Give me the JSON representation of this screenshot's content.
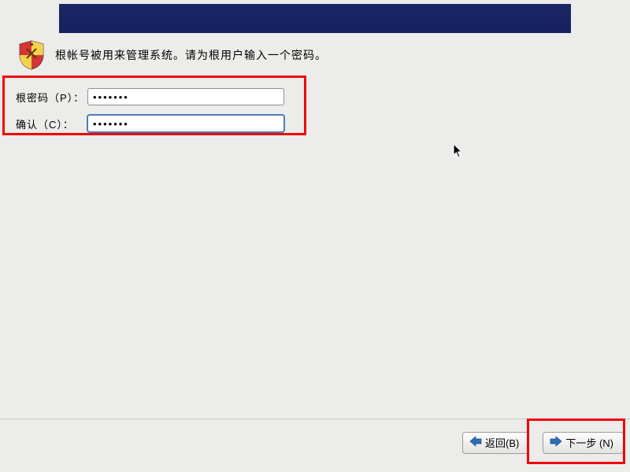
{
  "description": "根帐号被用来管理系统。请为根用户输入一个密码。",
  "form": {
    "password_label": "根密码（P）：",
    "password_value": "•••••••",
    "confirm_label": "确认（C）：",
    "confirm_value": "•••••••"
  },
  "buttons": {
    "back": "返回(B)",
    "next": "下一步 (N)"
  },
  "icons": {
    "shield": "shield-icon",
    "arrow_left": "arrow-left-icon",
    "arrow_right": "arrow-right-icon"
  }
}
